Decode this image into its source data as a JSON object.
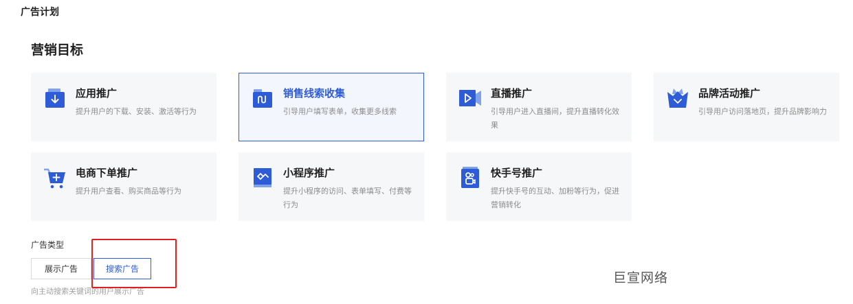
{
  "header": {
    "title": "广告计划"
  },
  "section": {
    "title": "营销目标"
  },
  "cards": [
    {
      "title": "应用推广",
      "desc": "提升用户的下载、安装、激活等行为",
      "icon": "app-download-icon",
      "selected": false
    },
    {
      "title": "销售线索收集",
      "desc": "引导用户填写表单，收集更多线索",
      "icon": "lead-form-icon",
      "selected": true
    },
    {
      "title": "直播推广",
      "desc": "引导用户进入直播间，提升直播转化效果",
      "icon": "live-video-icon",
      "selected": false
    },
    {
      "title": "品牌活动推广",
      "desc": "引导用户访问落地页，提升品牌影响力",
      "icon": "brand-crown-icon",
      "selected": false
    },
    {
      "title": "电商下单推广",
      "desc": "提升用户查看、购买商品等行为",
      "icon": "shopping-cart-icon",
      "selected": false
    },
    {
      "title": "小程序推广",
      "desc": "提升小程序的访问、表单填写、付费等行为",
      "icon": "mini-program-icon",
      "selected": false
    },
    {
      "title": "快手号推广",
      "desc": "提升快手号的互动、加粉等行为，促进营销转化",
      "icon": "kuaishou-account-icon",
      "selected": false
    }
  ],
  "ad_type": {
    "label": "广告类型",
    "options": [
      "展示广告",
      "搜索广告"
    ],
    "selected": "搜索广告",
    "help": "向主动搜索关键词的用户展示广告"
  },
  "watermark": "巨宣网络",
  "colors": {
    "accent": "#2e5bd6",
    "highlight": "#e02020",
    "card_bg": "#f6f7f9"
  }
}
